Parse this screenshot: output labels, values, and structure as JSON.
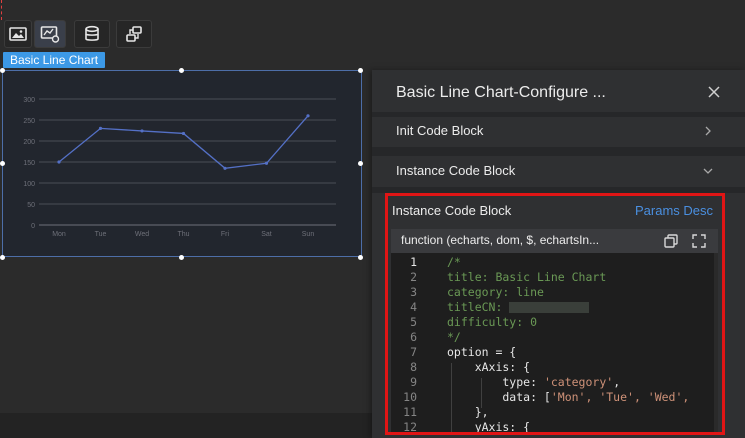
{
  "chart_widget": {
    "tag_label": "Basic Line Chart"
  },
  "chart_data": {
    "type": "line",
    "categories": [
      "Mon",
      "Tue",
      "Wed",
      "Thu",
      "Fri",
      "Sat",
      "Sun"
    ],
    "values": [
      150,
      230,
      224,
      218,
      135,
      147,
      260
    ],
    "yticks": [
      0,
      50,
      100,
      150,
      200,
      250,
      300
    ],
    "ylim": [
      0,
      300
    ],
    "line_color": "#5470c6"
  },
  "panel": {
    "title": "Basic Line Chart-Configure ...",
    "init_section": "Init Code Block",
    "instance_section": "Instance Code Block",
    "code_block_heading": "Instance Code Block",
    "params_desc": "Params Desc",
    "function_signature": "function (echarts, dom, $, echartsIn...",
    "code_lines": [
      {
        "n": "1",
        "cls": "c-comment",
        "text": "/*"
      },
      {
        "n": "2",
        "cls": "c-comment",
        "text": "title: Basic Line Chart"
      },
      {
        "n": "3",
        "cls": "c-comment",
        "text": "category: line"
      },
      {
        "n": "4",
        "cls": "c-comment",
        "text": "titleCN: "
      },
      {
        "n": "5",
        "cls": "c-comment",
        "text": "difficulty: 0"
      },
      {
        "n": "6",
        "cls": "c-comment",
        "text": "*/"
      },
      {
        "n": "7",
        "cls": "c-plain",
        "text": "option = {"
      },
      {
        "n": "8",
        "cls": "c-plain",
        "text": "    xAxis: {"
      },
      {
        "n": "9",
        "cls": "c-plain",
        "text": "        type: "
      },
      {
        "n": "10",
        "cls": "c-plain",
        "text": "        data: ["
      },
      {
        "n": "11",
        "cls": "c-plain",
        "text": "    },"
      },
      {
        "n": "12",
        "cls": "c-plain",
        "text": "    yAxis: {"
      }
    ],
    "code_strings": {
      "type_value": "'category'",
      "type_tail": ",",
      "data_values": "'Mon', 'Tue', 'Wed',"
    }
  },
  "colors": {
    "accent": "#3c99e6",
    "highlight": "#e01515",
    "link": "#4a8fe0"
  }
}
